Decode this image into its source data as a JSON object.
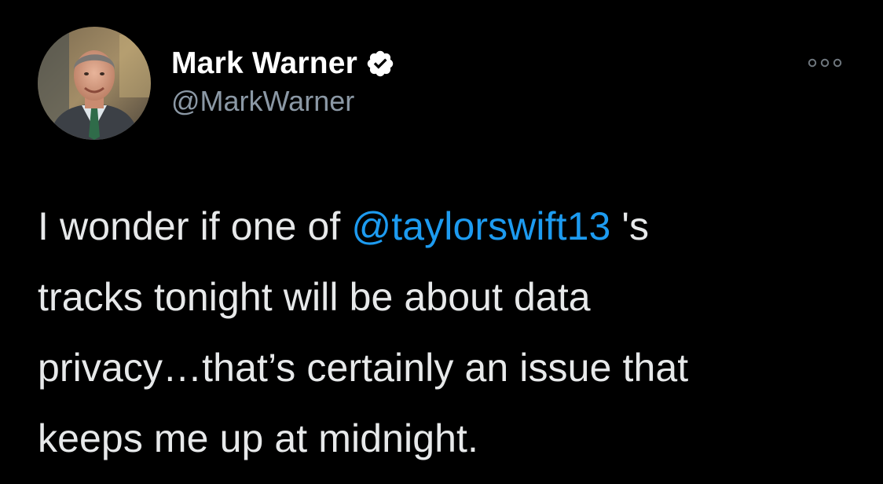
{
  "tweet": {
    "author": {
      "display_name": "Mark Warner",
      "handle": "@MarkWarner",
      "verified_icon": "verified-badge-icon",
      "avatar_icon": "profile-photo"
    },
    "more_icon": "more-options-icon",
    "text": {
      "line1_before": "I wonder if one of ",
      "mention": "@taylorswift13",
      "line1_after": " 's",
      "line2": "tracks tonight will be about data",
      "line3": "privacy…that’s certainly an issue that",
      "line4": "keeps me up at midnight."
    }
  },
  "colors": {
    "background": "#000000",
    "text": "#e7e9ea",
    "secondary_text": "#8b98a5",
    "link": "#1d9bf0"
  }
}
